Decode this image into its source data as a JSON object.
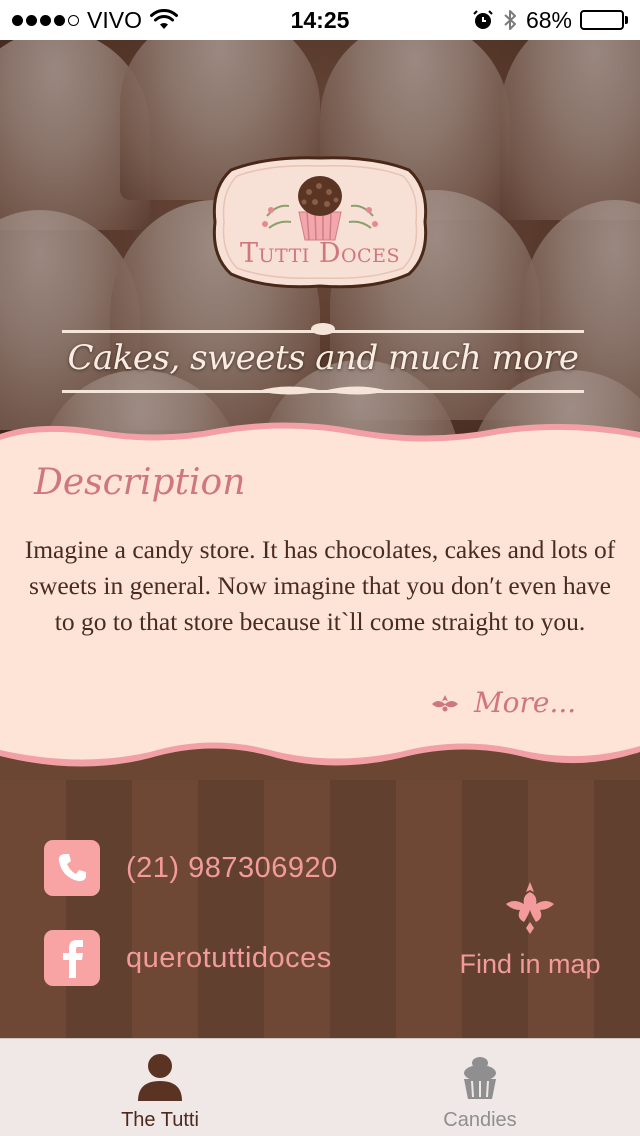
{
  "status_bar": {
    "carrier": "VIVO",
    "time": "14:25",
    "battery_percent": "68%",
    "battery_level": 0.68,
    "signal_bars_filled": 4,
    "signal_bars_total": 5,
    "icons": [
      "signal-dots-icon",
      "wifi-icon",
      "alarm-icon",
      "bluetooth-icon",
      "battery-icon"
    ]
  },
  "hero": {
    "logo_text": "Tutti Doces",
    "tagline": "Cakes, sweets and much more"
  },
  "description": {
    "title": "Description",
    "body": "Imagine a candy store. It has chocolates, cakes and lots of sweets in general. Now imagine that you don′t even have to go to that store because it`ll come straight to you.",
    "more_label": "More..."
  },
  "contact": {
    "phone": "(21) 987306920",
    "facebook": "querotuttidoces",
    "map_label": "Find in map"
  },
  "tab_bar": {
    "tabs": [
      {
        "label": "The Tutti",
        "icon": "person-icon",
        "active": true
      },
      {
        "label": "Candies",
        "icon": "cupcake-icon",
        "active": false
      }
    ]
  },
  "colors": {
    "accent_pink": "#f29a9c",
    "title_pink": "#d0767d",
    "card_bg": "#fde4d7",
    "card_border": "#f2a0a6",
    "brown_dark": "#614030",
    "brown_light": "#6e4834",
    "tab_active": "#4c2a1e",
    "tab_inactive": "#8f8f8f"
  }
}
